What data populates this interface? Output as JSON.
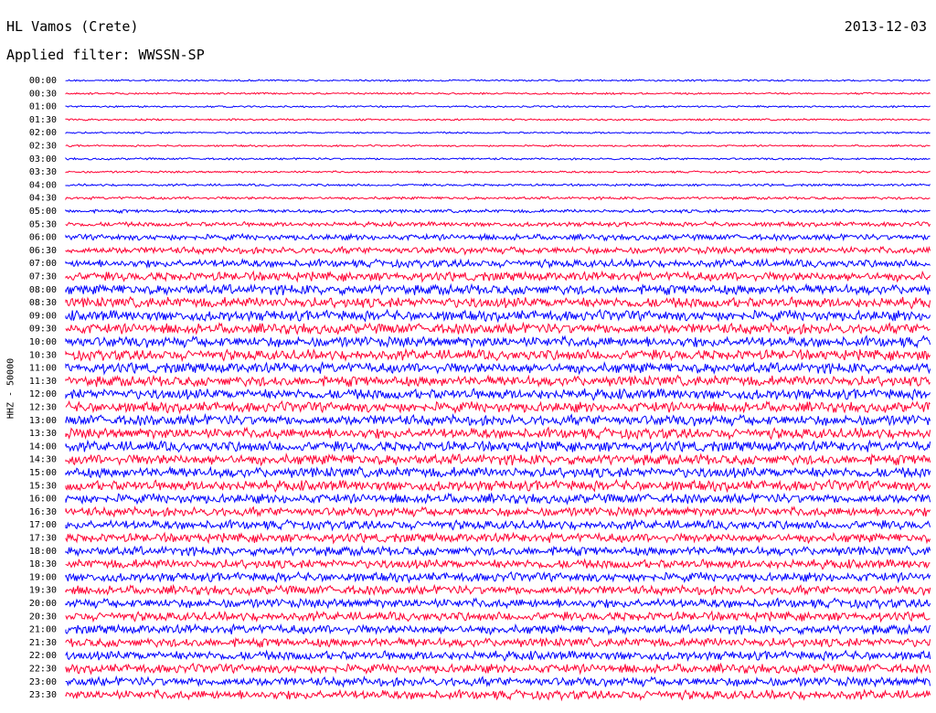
{
  "header": {
    "station": "HL Vamos (Crete)",
    "date": "2013-12-03",
    "filter": "Applied filter: WWSSN-SP"
  },
  "axis": {
    "scale_label": "HHZ - 50000"
  },
  "colors": {
    "trace_a": "#0000ff",
    "trace_b": "#ff0033",
    "background": "#ffffff"
  },
  "chart_data": {
    "type": "line",
    "description_kind": "helicorder",
    "row_labels": [
      "00:00",
      "00:30",
      "01:00",
      "01:30",
      "02:00",
      "02:30",
      "03:00",
      "03:30",
      "04:00",
      "04:30",
      "05:00",
      "05:30",
      "06:00",
      "06:30",
      "07:00",
      "07:30",
      "08:00",
      "08:30",
      "09:00",
      "09:30",
      "10:00",
      "10:30",
      "11:00",
      "11:30",
      "12:00",
      "12:30",
      "13:00",
      "13:30",
      "14:00",
      "14:30",
      "15:00",
      "15:30",
      "16:00",
      "16:30",
      "17:00",
      "17:30",
      "18:00",
      "18:30",
      "19:00",
      "19:30",
      "20:00",
      "20:30",
      "21:00",
      "21:30",
      "22:00",
      "22:30",
      "23:00",
      "23:30"
    ],
    "row_noise_level": [
      0.8,
      0.8,
      0.8,
      0.8,
      0.8,
      0.8,
      0.9,
      0.9,
      1.0,
      1.2,
      1.5,
      2.0,
      2.6,
      3.0,
      3.4,
      4.0,
      4.4,
      4.6,
      4.6,
      4.6,
      4.6,
      4.6,
      4.6,
      4.6,
      4.6,
      4.6,
      4.6,
      4.6,
      4.6,
      4.6,
      4.6,
      4.6,
      4.2,
      4.0,
      4.0,
      4.0,
      4.0,
      4.0,
      4.0,
      4.0,
      4.0,
      4.0,
      4.0,
      4.0,
      4.0,
      4.0,
      4.0,
      4.0
    ],
    "row_colors": [
      "a",
      "b"
    ]
  }
}
